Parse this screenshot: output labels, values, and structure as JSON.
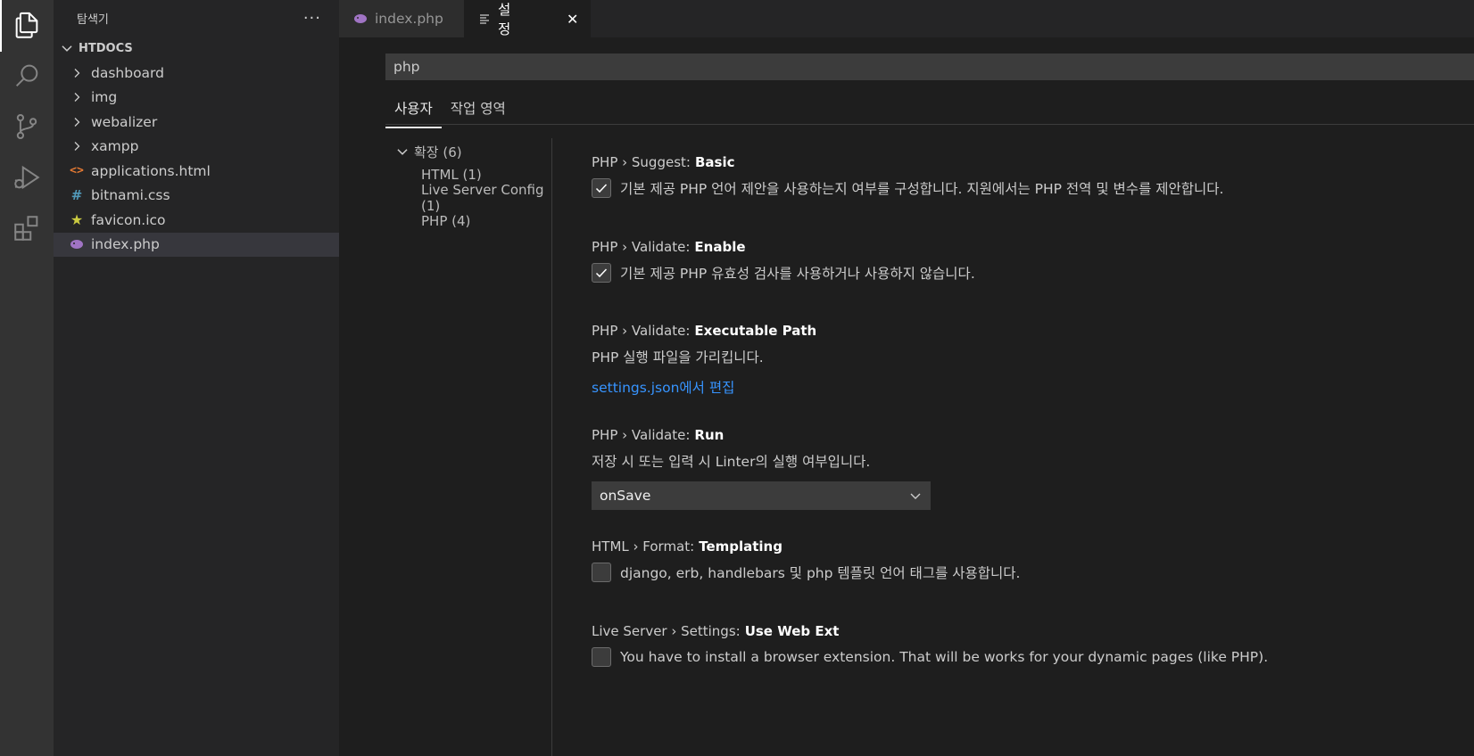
{
  "sidebar": {
    "title": "탐색기",
    "more": "···",
    "folder": "HTDOCS",
    "items": [
      {
        "label": "dashboard",
        "type": "folder"
      },
      {
        "label": "img",
        "type": "folder"
      },
      {
        "label": "webalizer",
        "type": "folder"
      },
      {
        "label": "xampp",
        "type": "folder"
      },
      {
        "label": "applications.html",
        "type": "html",
        "icon": "<>"
      },
      {
        "label": "bitnami.css",
        "type": "css",
        "icon": "#"
      },
      {
        "label": "favicon.ico",
        "type": "ico",
        "icon": "★"
      },
      {
        "label": "index.php",
        "type": "php"
      }
    ]
  },
  "tabs": [
    {
      "label": "index.php",
      "icon": "php-elephant-icon"
    },
    {
      "label": "설정",
      "icon": "settings-lines-icon",
      "close": "✕"
    }
  ],
  "settings_editor": {
    "search_value": "php",
    "scope_tabs": [
      "사용자",
      "작업 영역"
    ],
    "toc": {
      "root": "확장 (6)",
      "children": [
        "HTML (1)",
        "Live Server Config (1)",
        "PHP (4)"
      ]
    },
    "settings": [
      {
        "category": "PHP › Suggest:",
        "key": "Basic",
        "description": "기본 제공 PHP 언어 제안을 사용하는지 여부를 구성합니다. 지원에서는 PHP 전역 및 변수를 제안합니다.",
        "checked": true
      },
      {
        "category": "PHP › Validate:",
        "key": "Enable",
        "description": "기본 제공 PHP 유효성 검사를 사용하거나 사용하지 않습니다.",
        "checked": true
      },
      {
        "category": "PHP › Validate:",
        "key": "Executable Path",
        "description": "PHP 실행 파일을 가리킵니다.",
        "link": "settings.json에서 편집"
      },
      {
        "category": "PHP › Validate:",
        "key": "Run",
        "description": "저장 시 또는 입력 시 Linter의 실행 여부입니다.",
        "select_value": "onSave"
      },
      {
        "category": "HTML › Format:",
        "key": "Templating",
        "description": "django, erb, handlebars 및 php 템플릿 언어 태그를 사용합니다.",
        "checked": false
      },
      {
        "category": "Live Server › Settings:",
        "key": "Use Web Ext",
        "description": "You have to install a browser extension. That will be works for your dynamic pages (like PHP).",
        "checked": false
      }
    ]
  },
  "colors": {
    "activity_bar": "#333333",
    "sidebar": "#252526",
    "editor": "#1e1e1e",
    "link": "#3794ff",
    "php_icon": "#a074c4"
  }
}
